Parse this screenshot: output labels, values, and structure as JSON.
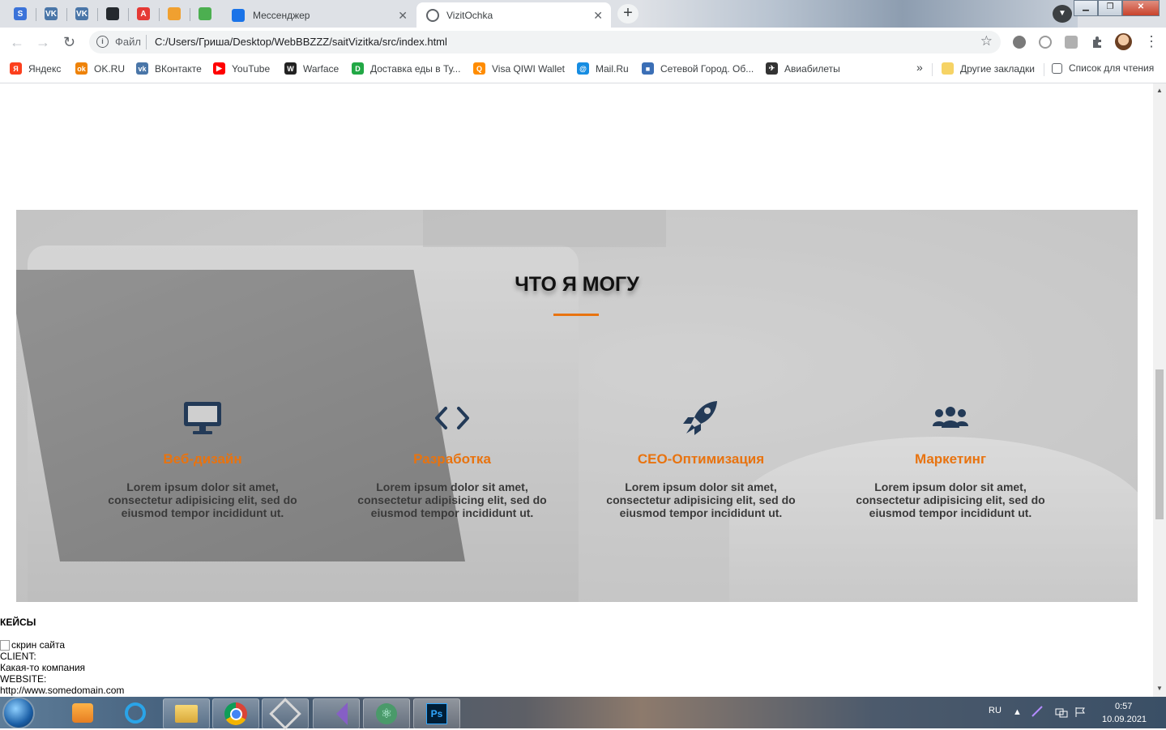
{
  "browser": {
    "pinned_tabs": [
      {
        "icon": "s-icon",
        "letter": "S",
        "color": "#3b73d9"
      },
      {
        "icon": "vk-icon",
        "letter": "VK",
        "color": "#4a76a8"
      },
      {
        "icon": "vk-icon",
        "letter": "VK",
        "color": "#4a76a8"
      },
      {
        "icon": "github-icon",
        "letter": "",
        "color": "#24292e"
      },
      {
        "icon": "a-icon",
        "letter": "A",
        "color": "#e53935"
      },
      {
        "icon": "game-icon",
        "letter": "",
        "color": "#f0a030"
      },
      {
        "icon": "chameleon-icon",
        "letter": "",
        "color": "#4caf50"
      }
    ],
    "tabs": [
      {
        "title": "Мессенджер",
        "close": "✕"
      },
      {
        "title": "VizitOchka",
        "close": "✕"
      }
    ],
    "new_tab": "+",
    "window_buttons": {
      "minimize": "▁",
      "maximize": "❐",
      "close": "✕"
    },
    "toolbar": {
      "back": "←",
      "forward": "→",
      "reload": "↻",
      "info": "i",
      "scheme": "Файл",
      "url": "C:/Users/Гриша/Desktop/WebBBZZZ/saitVizitka/src/index.html",
      "star": "☆",
      "menu": "⋮"
    },
    "bookmarks": [
      {
        "label": "Яндекс",
        "icon": "yandex-icon",
        "color": "#fc3f1d",
        "letter": "Я"
      },
      {
        "label": "OK.RU",
        "icon": "ok-icon",
        "color": "#ee8208",
        "letter": "ok"
      },
      {
        "label": "ВКонтакте",
        "icon": "vk-icon",
        "color": "#4a76a8",
        "letter": "vk"
      },
      {
        "label": "YouTube",
        "icon": "youtube-icon",
        "color": "#ff0000",
        "letter": "▶"
      },
      {
        "label": "Warface",
        "icon": "warface-icon",
        "color": "#222222",
        "letter": "W"
      },
      {
        "label": "Доставка еды в Ту...",
        "icon": "delivery-icon",
        "color": "#22a845",
        "letter": "D"
      },
      {
        "label": "Visa QIWI Wallet",
        "icon": "qiwi-icon",
        "color": "#ff8c00",
        "letter": "Q"
      },
      {
        "label": "Mail.Ru",
        "icon": "mailru-icon",
        "color": "#168de2",
        "letter": "@"
      },
      {
        "label": "Сетевой Город. Об...",
        "icon": "netcity-icon",
        "color": "#3b6fb6",
        "letter": "■"
      },
      {
        "label": "Авиабилеты",
        "icon": "plane-icon",
        "color": "#333333",
        "letter": "✈"
      }
    ],
    "bookmarks_more": "»",
    "other_bookmarks": "Другие закладки",
    "reading_list": "Список для чтения"
  },
  "page": {
    "services": {
      "title": "ЧТО Я МОГУ",
      "items": [
        {
          "icon": "monitor-icon",
          "name": "Веб-дизайн",
          "desc": "Lorem ipsum dolor sit amet, consectetur adipisicing elit, sed do eiusmod tempor incididunt ut."
        },
        {
          "icon": "code-icon",
          "name": "Разработка",
          "desc": "Lorem ipsum dolor sit amet, consectetur adipisicing elit, sed do eiusmod tempor incididunt ut."
        },
        {
          "icon": "rocket-icon",
          "name": "СЕО-Оптимизация",
          "desc": "Lorem ipsum dolor sit amet, consectetur adipisicing elit, sed do eiusmod tempor incididunt ut."
        },
        {
          "icon": "users-icon",
          "name": "Маркетинг",
          "desc": "Lorem ipsum dolor sit amet, consectetur adipisicing elit, sed do eiusmod tempor incididunt ut."
        }
      ]
    },
    "cases": {
      "title": "КЕЙСЫ",
      "image_alt": "скрин сайта",
      "client_label": "CLIENT:",
      "client_value": "Какая-то компания",
      "website_label": "WEBSITE:",
      "website_value": "http://www.somedomain.com"
    }
  },
  "taskbar": {
    "apps": [
      "media-player-icon",
      "internet-explorer-icon",
      "file-explorer-icon",
      "chrome-icon",
      "virtualbox-icon",
      "visual-studio-icon",
      "atom-icon",
      "photoshop-icon"
    ],
    "language": "RU",
    "time": "0:57",
    "date": "10.09.2021"
  },
  "colors": {
    "accent": "#e8730f",
    "icon_dark": "#233a57"
  }
}
